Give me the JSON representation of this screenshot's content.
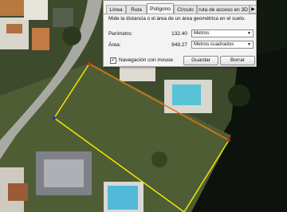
{
  "tabs": [
    {
      "label": "Línea"
    },
    {
      "label": "Ruta"
    },
    {
      "label": "Polígono"
    },
    {
      "label": "Círculo"
    },
    {
      "label": "ruta de acceso en 3D"
    }
  ],
  "active_tab": "Polígono",
  "tab_scroll_icon": "▶",
  "description": "Mide la distancia o el área de un área geométrica en el suelo.",
  "perimeter": {
    "label": "Perímetro:",
    "value": "132.40",
    "unit": "Metros"
  },
  "area": {
    "label": "Área:",
    "value": "949.27",
    "unit": "Metros cuadrados"
  },
  "mouse_nav": {
    "label": "Navegación con mouse",
    "checked": true,
    "mark": "✓"
  },
  "buttons": {
    "save": "Guardar",
    "clear": "Borrar"
  },
  "dropdown_icon": "▼",
  "colors": {
    "polygon_edge": "#f2e600",
    "vertex": "#e02020",
    "vertex_alt": "#2030d0"
  }
}
